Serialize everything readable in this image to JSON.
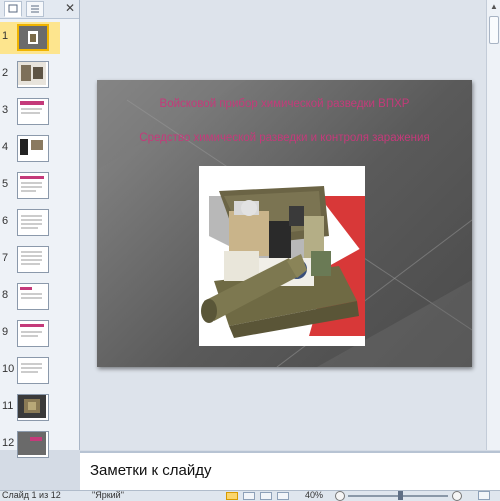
{
  "thumbnails": [
    {
      "num": "1",
      "selected": true
    },
    {
      "num": "2"
    },
    {
      "num": "3"
    },
    {
      "num": "4"
    },
    {
      "num": "5"
    },
    {
      "num": "6"
    },
    {
      "num": "7"
    },
    {
      "num": "8"
    },
    {
      "num": "9"
    },
    {
      "num": "10"
    },
    {
      "num": "11"
    },
    {
      "num": "12"
    }
  ],
  "slide": {
    "title": "Войсковой прибор химической разведки ВПХР",
    "subtitle": "Средство химической разведки и контроля заражения"
  },
  "notes": {
    "placeholder": "Заметки к слайду"
  },
  "status_bar": {
    "slide_indicator": "Слайд 1 из 12",
    "theme": "\"Яркий\"",
    "zoom": "40%"
  },
  "colors": {
    "slide_text": "#c43a7a",
    "selected_thumb": "#f0b400",
    "pane_background": "#eef2f7"
  }
}
